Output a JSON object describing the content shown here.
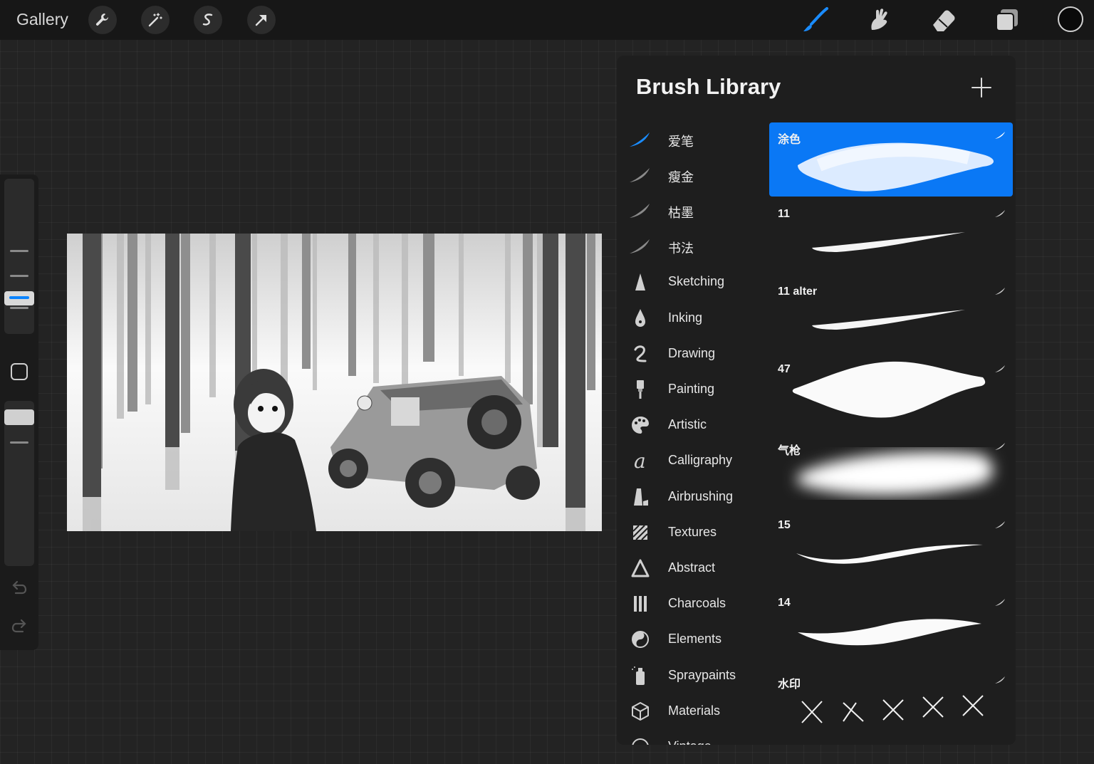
{
  "topbar": {
    "gallery_label": "Gallery",
    "left_tools": [
      "wrench-icon",
      "magic-wand-icon",
      "selection-icon",
      "transform-arrow-icon"
    ],
    "right_tools": [
      "brush-icon",
      "smudge-icon",
      "eraser-icon",
      "layers-icon"
    ],
    "active_tool": "brush",
    "color_swatch": "#0a0a0a"
  },
  "sidebar": {
    "brush_size_label": "",
    "icons": [
      "modify-square-icon",
      "undo-icon",
      "redo-icon"
    ],
    "accent": "#0a84ff"
  },
  "panel": {
    "title": "Brush Library",
    "add_icon": "plus-icon",
    "categories": [
      {
        "label": "爱笔",
        "icon": "brush-stroke-icon",
        "active": true
      },
      {
        "label": "瘦金",
        "icon": "brush-stroke-icon"
      },
      {
        "label": "枯墨",
        "icon": "brush-stroke-icon"
      },
      {
        "label": "书法",
        "icon": "brush-stroke-icon"
      },
      {
        "label": "Sketching",
        "icon": "pencil-tip-icon"
      },
      {
        "label": "Inking",
        "icon": "ink-drop-icon"
      },
      {
        "label": "Drawing",
        "icon": "squiggle-icon"
      },
      {
        "label": "Painting",
        "icon": "paintbrush-icon"
      },
      {
        "label": "Artistic",
        "icon": "palette-icon"
      },
      {
        "label": "Calligraphy",
        "icon": "calligraphy-a-icon"
      },
      {
        "label": "Airbrushing",
        "icon": "airbrush-icon"
      },
      {
        "label": "Textures",
        "icon": "texture-icon"
      },
      {
        "label": "Abstract",
        "icon": "triangle-icon"
      },
      {
        "label": "Charcoals",
        "icon": "charcoal-icon"
      },
      {
        "label": "Elements",
        "icon": "yin-yang-icon"
      },
      {
        "label": "Spraypaints",
        "icon": "spray-can-icon"
      },
      {
        "label": "Materials",
        "icon": "cube-icon"
      },
      {
        "label": "Vintage",
        "icon": "vintage-icon"
      }
    ],
    "brushes": [
      {
        "name": "涂色",
        "selected": true,
        "preview": "textured-blob"
      },
      {
        "name": "11",
        "preview": "thin-taper"
      },
      {
        "name": "11 alter",
        "preview": "thin-taper"
      },
      {
        "name": "47",
        "preview": "rough-blob"
      },
      {
        "name": "气枪",
        "preview": "soft-airbrush"
      },
      {
        "name": "15",
        "preview": "curved-taper"
      },
      {
        "name": "14",
        "preview": "thick-curve"
      },
      {
        "name": "水印",
        "preview": "x-stamps"
      }
    ],
    "selected_color": "#0a78f5"
  }
}
